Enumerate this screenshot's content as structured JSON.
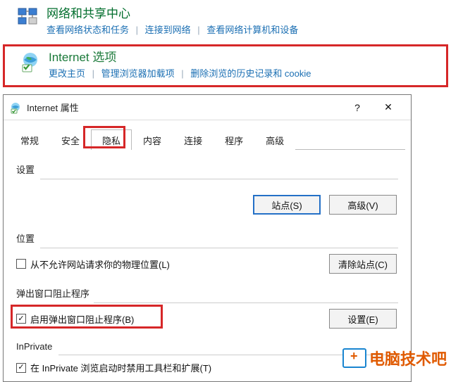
{
  "control_panel": {
    "item1": {
      "title": "网络和共享中心",
      "links": [
        "查看网络状态和任务",
        "连接到网络",
        "查看网络计算机和设备"
      ]
    },
    "item2": {
      "title": "Internet 选项",
      "links": [
        "更改主页",
        "管理浏览器加载项",
        "删除浏览的历史记录和 cookie"
      ]
    }
  },
  "dialog": {
    "title": "Internet 属性",
    "help_glyph": "?",
    "close_glyph": "✕",
    "tabs": [
      "常规",
      "安全",
      "隐私",
      "内容",
      "连接",
      "程序",
      "高级"
    ],
    "privacy": {
      "settings_head": "设置",
      "sites_btn": "站点(S)",
      "advanced_btn": "高级(V)",
      "location_head": "位置",
      "location_chk": "从不允许网站请求你的物理位置(L)",
      "clear_sites_btn": "清除站点(C)",
      "popup_head": "弹出窗口阻止程序",
      "popup_chk": "启用弹出窗口阻止程序(B)",
      "settings_btn": "设置(E)",
      "inprivate_head": "InPrivate",
      "inprivate_chk": "在 InPrivate 浏览启动时禁用工具栏和扩展(T)"
    }
  },
  "watermark": {
    "text": "电脑技术吧"
  }
}
